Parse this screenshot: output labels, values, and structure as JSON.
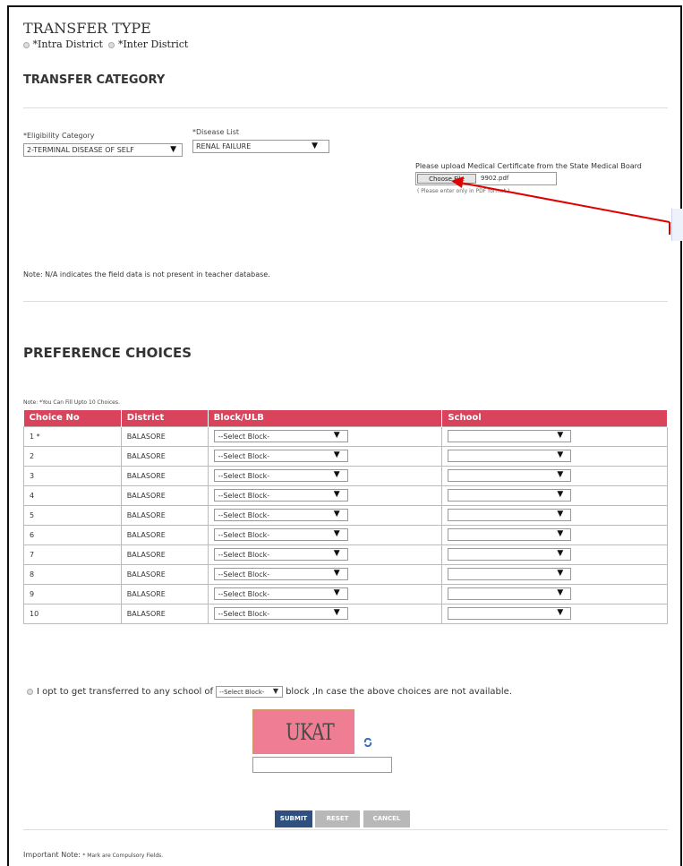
{
  "transfer_type": {
    "title": "TRANSFER TYPE",
    "options": [
      "*Intra District",
      "*Inter District"
    ]
  },
  "transfer_category": {
    "title": "TRANSFER CATEGORY"
  },
  "eligibility": {
    "label": "*Eligibility Category",
    "value": "2-TERMINAL DISEASE OF SELF"
  },
  "disease": {
    "label": "*Disease List",
    "value": "RENAL FAILURE"
  },
  "upload": {
    "label": "Please upload Medical Certificate from the State Medical Board",
    "button": "Choose File",
    "filename": "9902.pdf",
    "hint": "( Please enter only in PDF format )"
  },
  "note_na": "Note: N/A indicates the field data is not present in teacher database.",
  "preference": {
    "title": "PREFERENCE CHOICES",
    "note": "Note: *You Can Fill Upto 10 Choices.",
    "columns": [
      "Choice No",
      "District",
      "Block/ULB",
      "School"
    ],
    "rows": [
      {
        "choice": "1 *",
        "district": "BALASORE",
        "block": "--Select Block-",
        "school": ""
      },
      {
        "choice": "2",
        "district": "BALASORE",
        "block": "--Select Block-",
        "school": ""
      },
      {
        "choice": "3",
        "district": "BALASORE",
        "block": "--Select Block-",
        "school": ""
      },
      {
        "choice": "4",
        "district": "BALASORE",
        "block": "--Select Block-",
        "school": ""
      },
      {
        "choice": "5",
        "district": "BALASORE",
        "block": "--Select Block-",
        "school": ""
      },
      {
        "choice": "6",
        "district": "BALASORE",
        "block": "--Select Block-",
        "school": ""
      },
      {
        "choice": "7",
        "district": "BALASORE",
        "block": "--Select Block-",
        "school": ""
      },
      {
        "choice": "8",
        "district": "BALASORE",
        "block": "--Select Block-",
        "school": ""
      },
      {
        "choice": "9",
        "district": "BALASORE",
        "block": "--Select Block-",
        "school": ""
      },
      {
        "choice": "10",
        "district": "BALASORE",
        "block": "--Select Block-",
        "school": ""
      }
    ]
  },
  "opt": {
    "text_before": "I opt to get transferred to any school of",
    "block_value": "--Select Block-",
    "text_after": "block ,In case the above choices are not available."
  },
  "captcha": {
    "text": "UKAT",
    "refresh_icon": "refresh-icon"
  },
  "buttons": {
    "submit": "SUBMIT",
    "reset": "RESET",
    "cancel": "CANCEL"
  },
  "important_note": {
    "label": "Important Note:",
    "text": "* Mark are Compulsory Fields."
  },
  "colors": {
    "table_header": "#d9435c",
    "submit": "#2f4f7f",
    "reset": "#b8b8b8",
    "captcha_bg": "#ef7e95",
    "arrow": "#e00000"
  }
}
